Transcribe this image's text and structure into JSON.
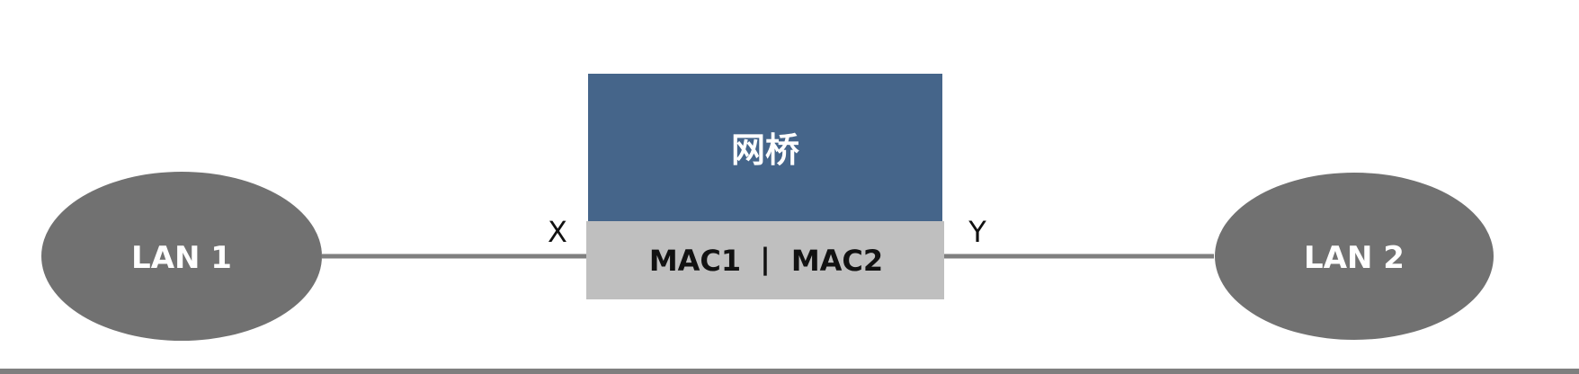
{
  "diagram": {
    "bridge": {
      "label": "网桥",
      "fill_color": "#45658a",
      "mac_row": {
        "left": "MAC1",
        "separator": "|",
        "right": "MAC2",
        "fill_color": "#bfbfbf"
      }
    },
    "nodes": [
      {
        "id": "lan1",
        "label": "LAN 1",
        "fill_color": "#717171"
      },
      {
        "id": "lan2",
        "label": "LAN 2",
        "fill_color": "#717171"
      }
    ],
    "ports": {
      "left": "X",
      "right": "Y"
    },
    "connection_color": "#7f7f7f",
    "footer_rule_color": "#7f7f7f"
  }
}
